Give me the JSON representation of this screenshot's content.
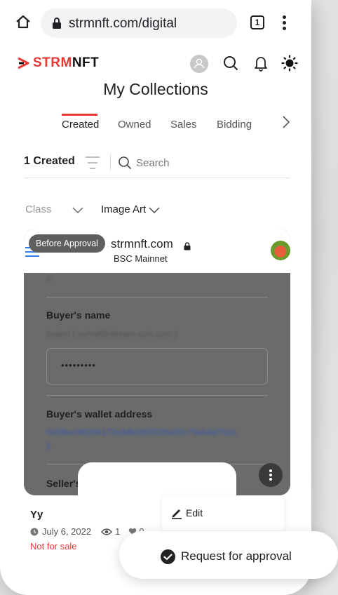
{
  "browser": {
    "url": "strmnft.com/digital",
    "tab_count": "1"
  },
  "header": {
    "logo_part1": "STRM",
    "logo_part2": "NFT",
    "title": "My Collections"
  },
  "tabs": [
    {
      "label": "Created",
      "active": true
    },
    {
      "label": "Owned",
      "active": false
    },
    {
      "label": "Sales",
      "active": false
    },
    {
      "label": "Bidding",
      "active": false
    }
  ],
  "filters": {
    "created_count": "1 Created",
    "search_placeholder": "Search",
    "class_label": "Class",
    "type_label": "Image Art"
  },
  "nft": {
    "badge": "Before Approval",
    "preview_site": "strmnft.com",
    "preview_network": "BSC Mainnet",
    "preview_hash": "#",
    "preview_buyer_name_label": "Buyer's name",
    "preview_buyer_name_value": "jsstest ( ashraf@stream-coin.com )",
    "preview_password": "•••••••••",
    "preview_wallet_label": "Buyer's wallet address",
    "preview_wallet_value": "0x5f8ec0f82b9172a3db0d9332f6a00c75eb4af7b2e",
    "preview_wallet_value2": "2",
    "preview_seller_label": "Seller's",
    "title": "Yy",
    "date": "July 6, 2022",
    "views": "1",
    "likes": "0",
    "status": "Not for sale"
  },
  "menu": {
    "edit": "Edit",
    "request": "Request for approval"
  },
  "colors": {
    "accent": "#e53935",
    "text": "#222222"
  }
}
